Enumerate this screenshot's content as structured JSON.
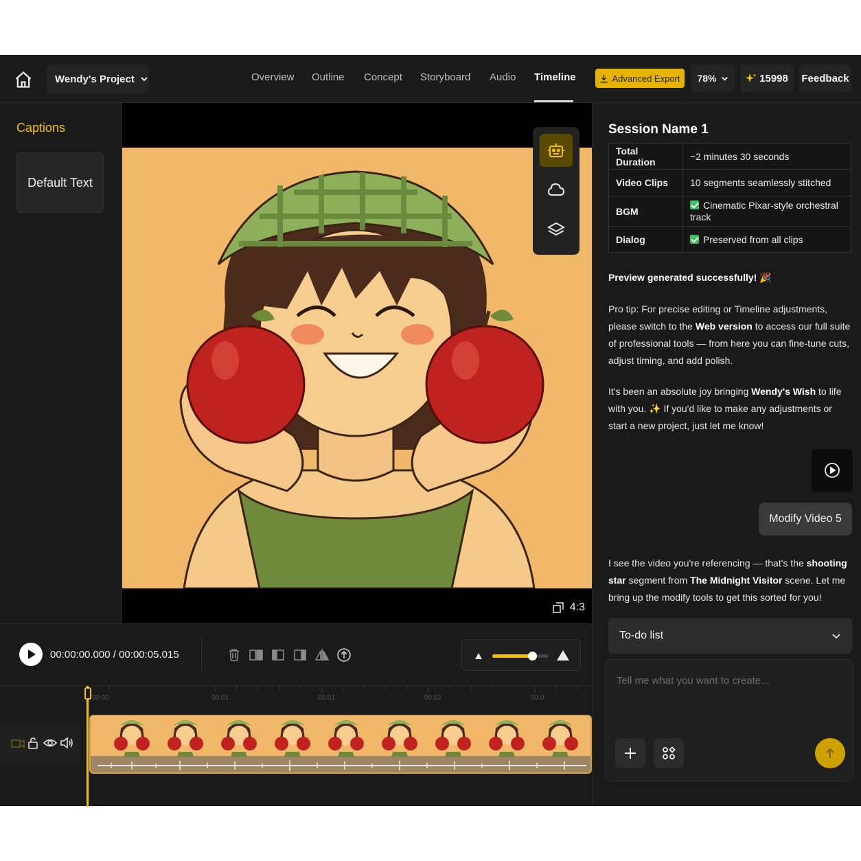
{
  "header": {
    "project_name": "Wendy's Project",
    "tabs": [
      {
        "label": "Overview"
      },
      {
        "label": "Outline"
      },
      {
        "label": "Concept"
      },
      {
        "label": "Storyboard"
      },
      {
        "label": "Audio"
      },
      {
        "label": "Timeline",
        "active": true
      }
    ],
    "export_label": "Advanced Export",
    "zoom": "78%",
    "credits": "15998",
    "feedback_label": "Feedback",
    "accent_color": "#e6b400"
  },
  "captions": {
    "title": "Captions",
    "preset": "Default Text"
  },
  "preview": {
    "aspect_ratio": "4:3"
  },
  "player": {
    "timecode": "00:00:00.000 / 00:00:05.015",
    "ruler_labels": [
      "00:00",
      "00:01",
      "00:01",
      "00:02",
      "00:0"
    ]
  },
  "session": {
    "title": "Session Name 1",
    "rows": [
      {
        "key": "Total Duration",
        "value": "~2 minutes 30 seconds"
      },
      {
        "key": "Video Clips",
        "value": "10 segments seamlessly stitched"
      },
      {
        "key": "BGM",
        "value": "Cinematic Pixar-style orchestral track",
        "checked": true
      },
      {
        "key": "Dialog",
        "value": "Preserved from all clips",
        "checked": true
      }
    ]
  },
  "chat": {
    "success": "Preview generated successfully! 🎉",
    "tip_1": "Pro tip: For precise editing or Timeline adjustments, please switch to the ",
    "tip_bold": "Web version",
    "tip_2": " to access our full suite of professional tools — from here you can fine-tune cuts, adjust timing, and add polish.",
    "joy_1": "It's been an absolute joy bringing ",
    "joy_bold": "Wendy's Wish",
    "joy_2": " to life with you. ✨ If you'd like to make any adjustments or start a new project, just let me know!",
    "user_message": "Modify Video 5",
    "reply_1": "I see the video you're referencing — that's the ",
    "reply_bold_1": "shooting star",
    "reply_2": " segment from ",
    "reply_bold_2": "The Midnight Visitor",
    "reply_3": " scene. Let me bring up the modify tools to get this sorted for you!",
    "todo_label": "To-do list",
    "input_placeholder": "Tell me what you want to create..."
  }
}
